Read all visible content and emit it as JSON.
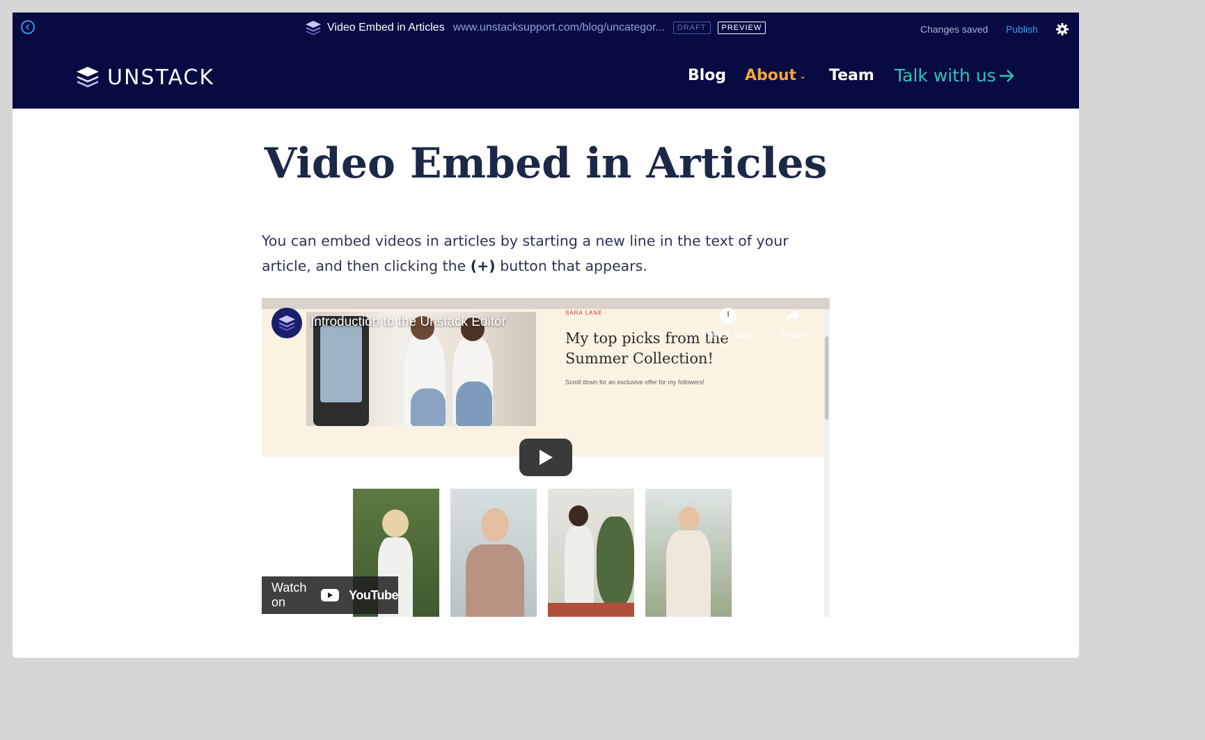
{
  "editor_bar": {
    "page_title": "Video Embed in Articles",
    "url": "www.unstacksupport.com/blog/uncategor...",
    "draft_badge": "DRAFT",
    "preview_badge": "PREVIEW",
    "status": "Changes saved",
    "publish_label": "Publish"
  },
  "site_nav": {
    "logo_text": "UNSTACK",
    "items": [
      {
        "label": "Blog"
      },
      {
        "label": "About"
      },
      {
        "label": "Team"
      }
    ],
    "cta_label": "Talk with us",
    "cta_icon": "arrow-right-icon"
  },
  "article": {
    "title": "Video Embed in Articles",
    "intro_part1": "You can embed videos in articles by starting a new line in the text of your article, and then clicking the ",
    "intro_bold": "(+)",
    "intro_part2": " button that appears."
  },
  "video": {
    "title": "Introduction to the Unstack Editor",
    "watch_later": "Watch later",
    "share": "Share",
    "watch_on": "Watch on",
    "youtube": "YouTube",
    "inner_brand": "SARA LANE",
    "inner_heading": "My top picks from the Summer Collection!",
    "inner_subtext": "Scroll down for an exclusive offer for my followers!"
  },
  "colors": {
    "nav_bg": "#070b42",
    "accent_about": "#f5a53d",
    "accent_cta": "#2ec4b6",
    "publish": "#3f9ee8",
    "title": "#1c2847"
  }
}
